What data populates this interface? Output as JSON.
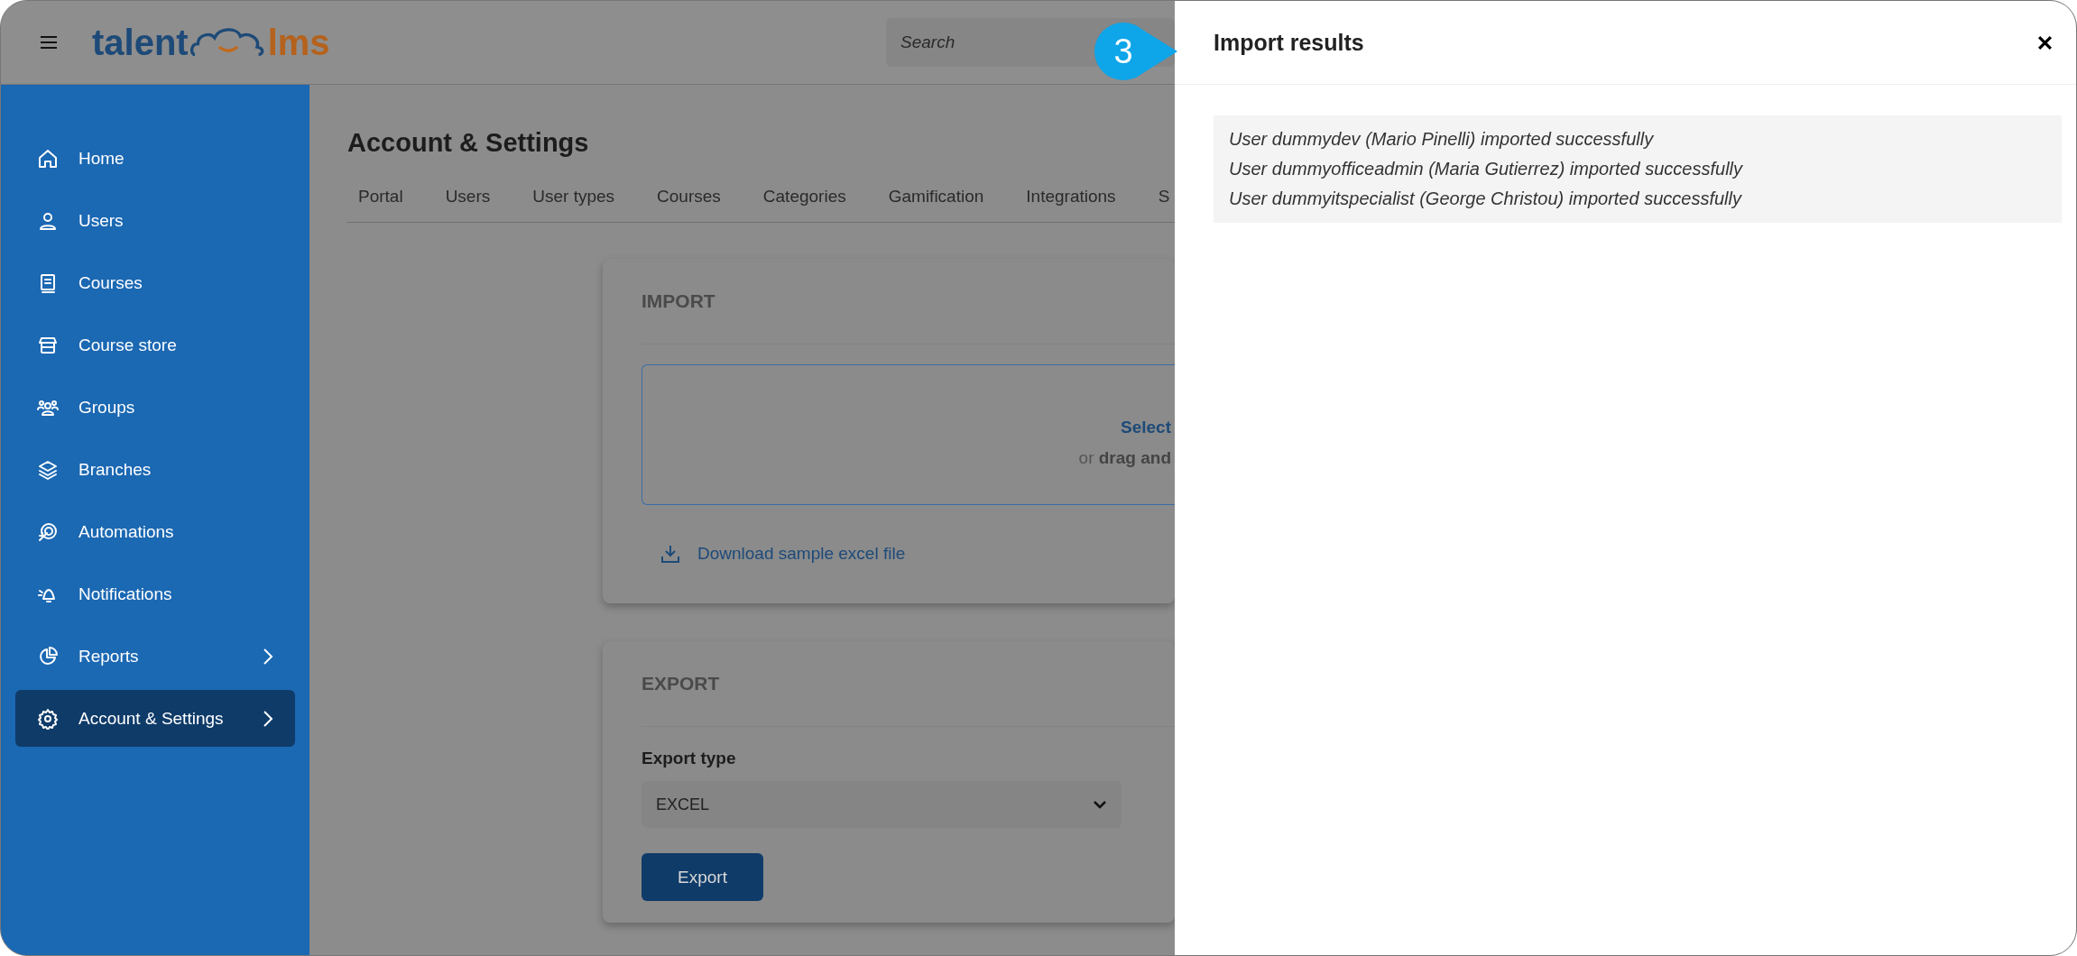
{
  "header": {
    "logo_left": "talent",
    "logo_right": "lms",
    "search": {
      "placeholder": "Search"
    }
  },
  "sidebar": {
    "items": [
      {
        "label": "Home",
        "selected": false,
        "has_submenu": false
      },
      {
        "label": "Users",
        "selected": false,
        "has_submenu": false
      },
      {
        "label": "Courses",
        "selected": false,
        "has_submenu": false
      },
      {
        "label": "Course store",
        "selected": false,
        "has_submenu": false
      },
      {
        "label": "Groups",
        "selected": false,
        "has_submenu": false
      },
      {
        "label": "Branches",
        "selected": false,
        "has_submenu": false
      },
      {
        "label": "Automations",
        "selected": false,
        "has_submenu": false
      },
      {
        "label": "Notifications",
        "selected": false,
        "has_submenu": false
      },
      {
        "label": "Reports",
        "selected": false,
        "has_submenu": true
      },
      {
        "label": "Account & Settings",
        "selected": true,
        "has_submenu": true
      }
    ]
  },
  "page": {
    "title": "Account & Settings",
    "tabs": [
      "Portal",
      "Users",
      "User types",
      "Courses",
      "Categories",
      "Gamification",
      "Integrations",
      "S"
    ]
  },
  "import_card": {
    "title": "IMPORT",
    "drop_zone": {
      "action": "Select",
      "hint": "or **drag and**"
    },
    "download_link": "Download sample excel file"
  },
  "export_card": {
    "title": "EXPORT",
    "field_label": "Export type",
    "select_value": "EXCEL",
    "button": "Export"
  },
  "callout": {
    "number": "3"
  },
  "drawer": {
    "title": "Import results",
    "results": [
      "User dummydev (Mario Pinelli) imported successfully",
      "User dummyofficeadmin (Maria Gutierrez) imported successfully",
      "User dummyitspecialist (George Christou) imported successfully"
    ]
  }
}
